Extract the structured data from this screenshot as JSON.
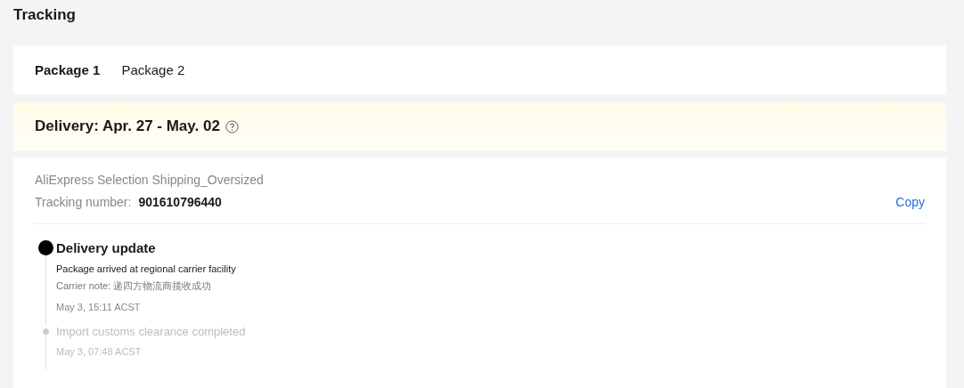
{
  "title": "Tracking",
  "tabs": [
    {
      "label": "Package 1",
      "selected": true
    },
    {
      "label": "Package 2",
      "selected": false
    }
  ],
  "delivery": {
    "text": "Delivery: Apr. 27 - May. 02"
  },
  "shipment": {
    "method": "AliExpress Selection Shipping_Oversized",
    "tracking_label": "Tracking number:",
    "tracking_number": "901610796440",
    "copy": "Copy"
  },
  "events": [
    {
      "title": "Delivery update",
      "current": true,
      "description": "Package arrived at regional carrier facility",
      "note": "Carrier note: 递四方物流商揽收成功",
      "time": "May 3, 15:11 ACST"
    },
    {
      "title": "Import customs clearance completed",
      "current": false,
      "time": "May 3, 07:48 ACST"
    }
  ]
}
